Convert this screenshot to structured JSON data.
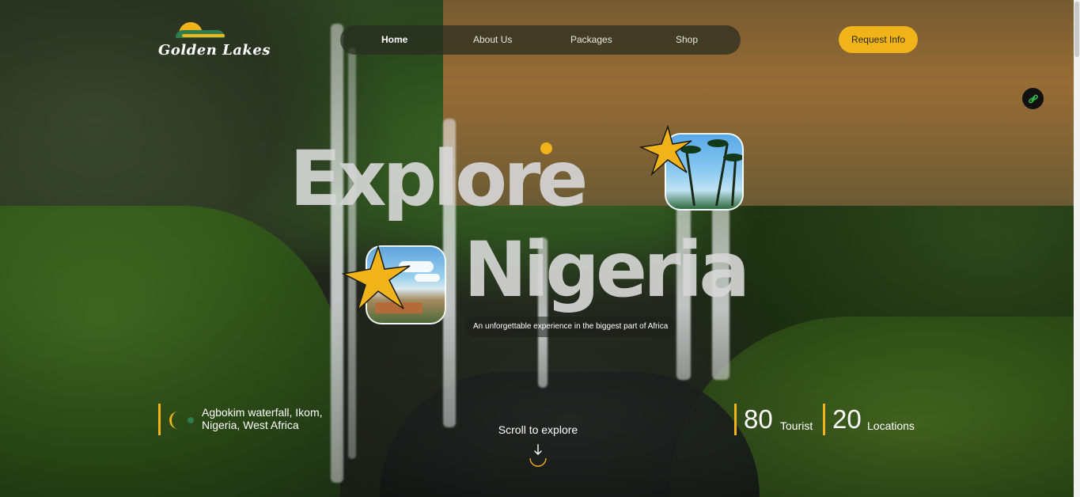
{
  "brand": {
    "name": "Golden Lakes"
  },
  "nav": {
    "items": [
      {
        "label": "Home",
        "active": true
      },
      {
        "label": "About Us"
      },
      {
        "label": "Packages"
      },
      {
        "label": "Shop"
      }
    ]
  },
  "header": {
    "cta_label": "Request Info"
  },
  "hero": {
    "line1": "Explore",
    "line2": "Nigeria",
    "tagline": "An unforgettable experience in the biggest part of Africa"
  },
  "location": {
    "line1": "Agbokim waterfall, Ikom,",
    "line2": "Nigeria, West Africa"
  },
  "scroll": {
    "label": "Scroll to explore"
  },
  "stats": [
    {
      "value": "80",
      "unit": "Tourist"
    },
    {
      "value": "20",
      "unit": "Locations"
    }
  ],
  "icons": {
    "link": "link-icon",
    "moon": "crescent-moon-icon",
    "arrow": "arrow-down-icon",
    "star": "star-burst-icon"
  },
  "colors": {
    "accent": "#f0b31a",
    "nav_bg": "#282c20",
    "cta_text": "#2a2a10"
  }
}
